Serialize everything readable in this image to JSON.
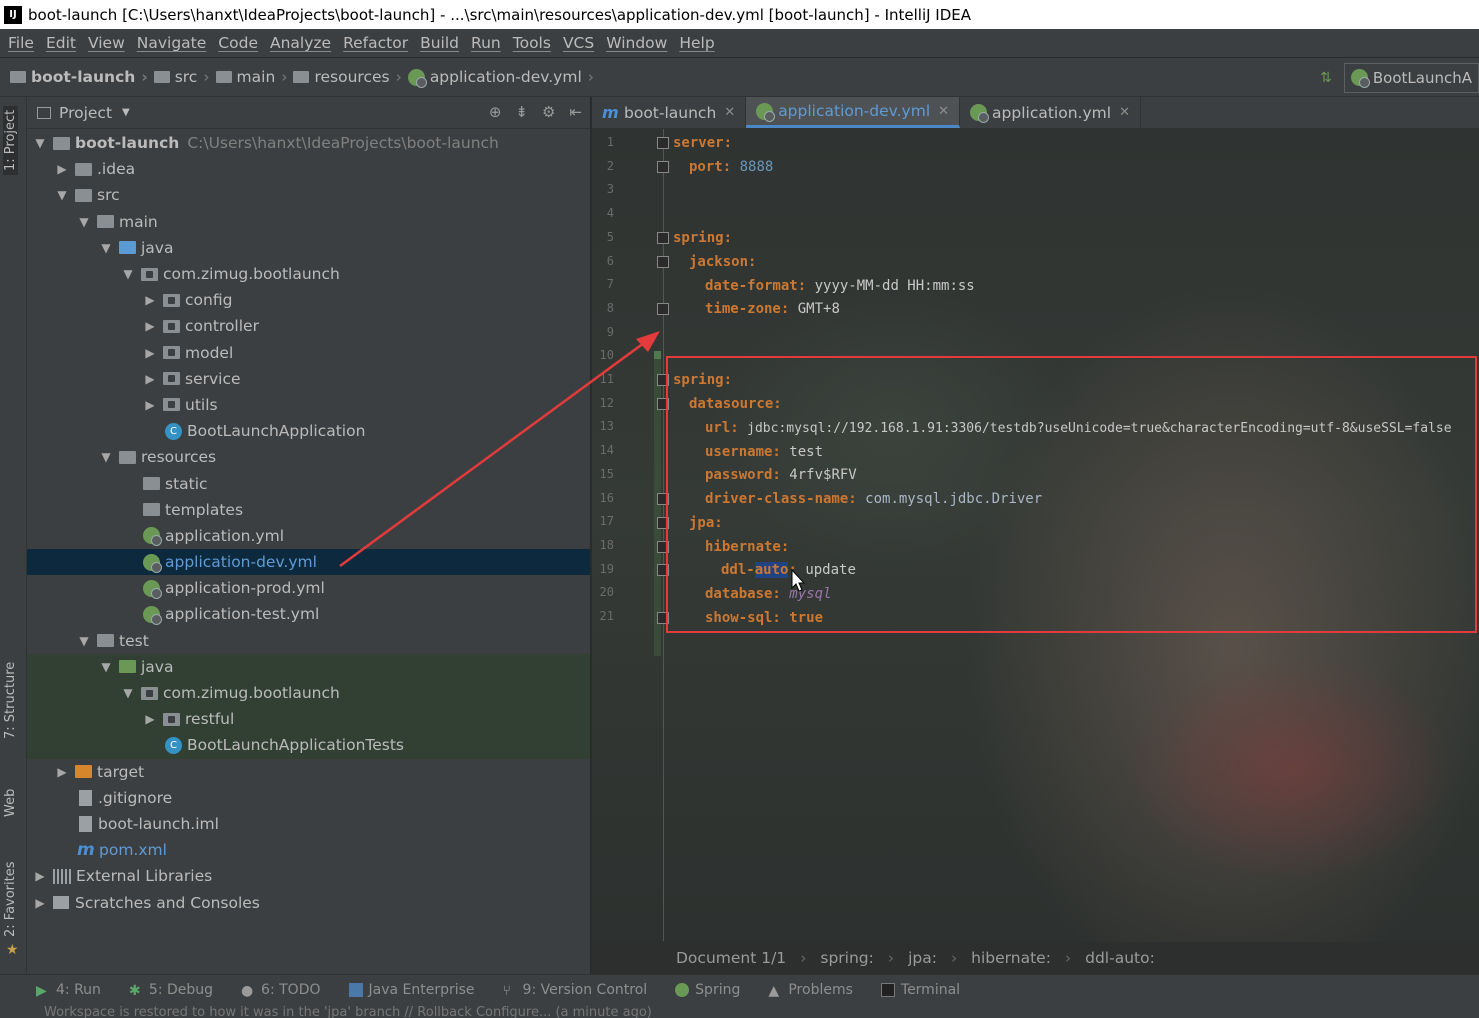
{
  "window": {
    "title": "boot-launch [C:\\Users\\hanxt\\IdeaProjects\\boot-launch] - ...\\src\\main\\resources\\application-dev.yml [boot-launch] - IntelliJ IDEA"
  },
  "menu": [
    "File",
    "Edit",
    "View",
    "Navigate",
    "Code",
    "Analyze",
    "Refactor",
    "Build",
    "Run",
    "Tools",
    "VCS",
    "Window",
    "Help"
  ],
  "navbar": {
    "crumbs": [
      "boot-launch",
      "src",
      "main",
      "resources",
      "application-dev.yml"
    ],
    "run_config": "BootLaunchA"
  },
  "left_stripe": {
    "project": "1: Project",
    "structure": "7: Structure",
    "web": "Web",
    "favorites": "2: Favorites"
  },
  "project_panel": {
    "title": "Project",
    "root_name": "boot-launch",
    "root_path": "C:\\Users\\hanxt\\IdeaProjects\\boot-launch",
    "items": {
      "idea": ".idea",
      "src": "src",
      "main": "main",
      "java": "java",
      "pkg": "com.zimug.bootlaunch",
      "config": "config",
      "controller": "controller",
      "model": "model",
      "service": "service",
      "utils": "utils",
      "app_class": "BootLaunchApplication",
      "resources": "resources",
      "static": "static",
      "templates": "templates",
      "app_yml": "application.yml",
      "app_dev_yml": "application-dev.yml",
      "app_prod_yml": "application-prod.yml",
      "app_test_yml": "application-test.yml",
      "test": "test",
      "test_java": "java",
      "test_pkg": "com.zimug.bootlaunch",
      "restful": "restful",
      "tests_class": "BootLaunchApplicationTests",
      "target": "target",
      "gitignore": ".gitignore",
      "iml": "boot-launch.iml",
      "pom": "pom.xml",
      "ext_libs": "External Libraries",
      "scratches": "Scratches and Consoles"
    }
  },
  "editor": {
    "tabs": [
      {
        "label": "boot-launch"
      },
      {
        "label": "application-dev.yml"
      },
      {
        "label": "application.yml"
      }
    ],
    "line_numbers": [
      "1",
      "2",
      "3",
      "4",
      "5",
      "6",
      "7",
      "8",
      "9",
      "10",
      "11",
      "12",
      "13",
      "14",
      "15",
      "16",
      "17",
      "18",
      "19",
      "20",
      "21"
    ],
    "code": {
      "l1_key": "server:",
      "l2_key": "port:",
      "l2_val": "8888",
      "l5_key": "spring:",
      "l6_key": "jackson:",
      "l7_key": "date-format:",
      "l7_val": "yyyy-MM-dd HH:mm:ss",
      "l8_key": "time-zone:",
      "l8_val": "GMT+8",
      "l11_key": "spring:",
      "l12_key": "datasource:",
      "l13_key": "url:",
      "l13_val": "jdbc:mysql://192.168.1.91:3306/testdb?useUnicode=true&characterEncoding=utf-8&useSSL=false",
      "l14_key": "username:",
      "l14_val": "test",
      "l15_key": "password:",
      "l15_val": "4rfv$RFV",
      "l16_key": "driver-class-name:",
      "l16_val": "com.mysql.jdbc.Driver",
      "l17_key": "jpa:",
      "l18_key": "hibernate:",
      "l19_key_a": "ddl-",
      "l19_key_b": "auto",
      "l19_colon": ":",
      "l19_val": "update",
      "l20_key": "database:",
      "l20_val": "mysql",
      "l21_key": "show-sql:",
      "l21_val": "true"
    },
    "breadcrumb": [
      "Document 1/1",
      "spring:",
      "jpa:",
      "hibernate:",
      "ddl-auto:"
    ]
  },
  "tool_windows": [
    {
      "label": "4: Run"
    },
    {
      "label": "5: Debug"
    },
    {
      "label": "6: TODO"
    },
    {
      "label": "Java Enterprise"
    },
    {
      "label": "9: Version Control"
    },
    {
      "label": "Spring"
    },
    {
      "label": "Problems"
    },
    {
      "label": "Terminal"
    }
  ],
  "status": "Workspace is restored to how it was in the 'jpa' branch // Rollback Configure... (a minute ago)",
  "colors": {
    "accent": "#4a88c7",
    "annotation_red": "#e33b3b",
    "yaml_key": "#cc7832",
    "number": "#6897bb"
  }
}
